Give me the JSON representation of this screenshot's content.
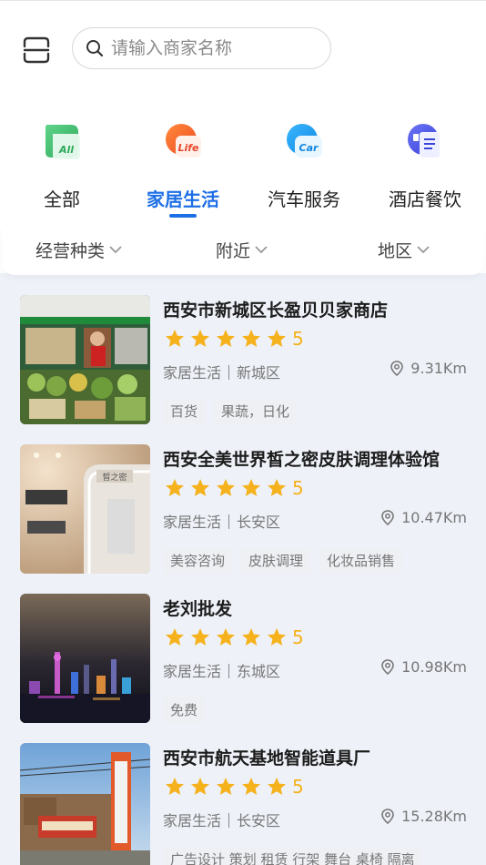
{
  "search": {
    "placeholder": "请输入商家名称"
  },
  "categories": [
    {
      "label": "全部",
      "icon_text": "All",
      "color": "#3dbb6a"
    },
    {
      "label": "家居生活",
      "icon_text": "Life",
      "color": "#f06422"
    },
    {
      "label": "汽车服务",
      "icon_text": "Car",
      "color": "#1a9ff0"
    },
    {
      "label": "酒店餐饮",
      "icon_text": "",
      "color": "#4c57e8"
    }
  ],
  "active_category": "家居生活",
  "filters": [
    {
      "label": "经营种类"
    },
    {
      "label": "附近"
    },
    {
      "label": "地区"
    }
  ],
  "shops": [
    {
      "name": "西安市新城区长盈贝贝家商店",
      "rating": "5",
      "category": "家居生活",
      "district": "新城区",
      "distance": "9.31Km",
      "tags": [
        "百货",
        "果蔬，日化"
      ]
    },
    {
      "name": "西安全美世界皙之密皮肤调理体验馆",
      "rating": "5",
      "category": "家居生活",
      "district": "长安区",
      "distance": "10.47Km",
      "tags": [
        "美容咨询",
        "皮肤调理",
        "化妆品销售"
      ]
    },
    {
      "name": "老刘批发",
      "rating": "5",
      "category": "家居生活",
      "district": "东城区",
      "distance": "10.98Km",
      "tags": [
        "免费"
      ]
    },
    {
      "name": "西安市航天基地智能道具厂",
      "rating": "5",
      "category": "家居生活",
      "district": "长安区",
      "distance": "15.28Km",
      "tags": [
        "广告设计 策划 租赁 行架 舞台 桌椅 隔离"
      ]
    }
  ],
  "colors": {
    "accent": "#1e6fe6",
    "star": "#f5b21d"
  }
}
